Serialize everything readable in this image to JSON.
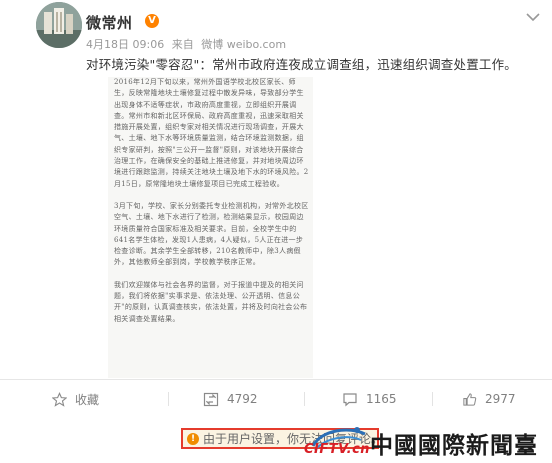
{
  "account": {
    "name": "微常州",
    "verified_badge": "V"
  },
  "post": {
    "date": "4月18日 09:06",
    "source_prefix": "来自",
    "source": "微博 weibo.com",
    "text": "对环境污染\"零容忍\"：常州市政府连夜成立调查组，迅速组织调查处置工作。"
  },
  "document": {
    "paragraphs": [
      "2016年12月下旬以来，常州外国语学校北校区家长、师生，反映常隆地块土壤修复过程中散发异味，导致部分学生出现身体不适等症状，市政府高度重视，立即组织开展调查。常州市和新北区环保局、政府高度重视，迅速采取相关措施开展处置，组织专家对相关情况进行现场调查，开展大气、土壤、地下水等环境质量监测，结合环境监测数据，组织专家研判，按照\"三公开一监督\"原则，对该地块开展综合治理工作，在确保安全的基础上推进修复，并对地块周边环境进行跟踪监测，持续关注地块土壤及地下水的环境风险。2月15日，原常隆地块土壤修复项目已完成工程验收。",
      "3月下旬，学校、家长分别委托专业检测机构，对常外北校区空气、土壤、地下水进行了检测，检测结果显示，校园周边环境质量符合国家标准及相关要求。目前，全校学生中的641名学生体检，发现1人患病，4人疑似，5人正在进一步检查诊断。其余学生全部转移，210名教师中，除3人病假外，其他教师全部到岗，学校教学秩序正常。",
      "我们欢迎媒体与社会各界的监督，对于报道中提及的相关问题，我们将依据\"实事求是、依法处理、公开透明、信息公开\"的原则，认真调查核实，依法处置，并将及时向社会公布相关调查处置结果。"
    ]
  },
  "actions": {
    "favorite": "收藏",
    "repost_count": "4792",
    "comment_count": "1165",
    "like_count": "2977"
  },
  "notice": {
    "icon": "!",
    "text": "由于用户设置，你无法回复评论。"
  },
  "watermark": {
    "brand": "CIFTV.cn",
    "name": "中國國際新聞臺"
  },
  "colors": {
    "accent": "#ff8200",
    "muted": "#999999",
    "notice_border": "#e53b2c",
    "notice_bg": "#fbf4e2",
    "brand_red": "#d81f26"
  }
}
